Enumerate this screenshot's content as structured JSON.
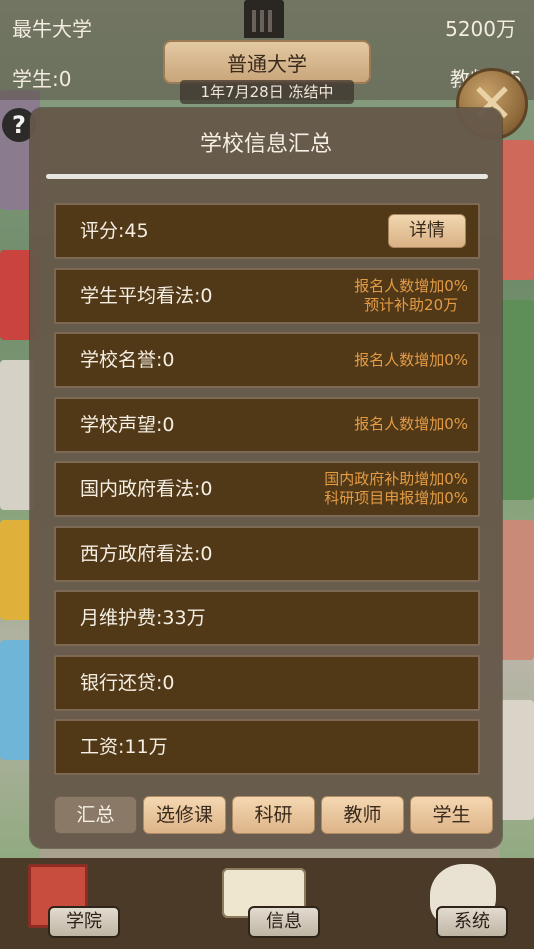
{
  "hud": {
    "university_name": "最牛大学",
    "money": "5200万",
    "students": "学生:0",
    "teachers": "教师:15",
    "level": "普通大学",
    "date_status": "1年7月28日 冻结中"
  },
  "panel": {
    "title": "学校信息汇总",
    "detail_button": "详情",
    "rows": [
      {
        "label": "评分:45",
        "notes": []
      },
      {
        "label": "学生平均看法:0",
        "notes": [
          "报名人数增加0%",
          "预计补助20万"
        ]
      },
      {
        "label": "学校名誉:0",
        "notes": [
          "报名人数增加0%"
        ]
      },
      {
        "label": "学校声望:0",
        "notes": [
          "报名人数增加0%"
        ]
      },
      {
        "label": "国内政府看法:0",
        "notes": [
          "国内政府补助增加0%",
          "科研项目申报增加0%"
        ]
      },
      {
        "label": "西方政府看法:0",
        "notes": []
      },
      {
        "label": "月维护费:33万",
        "notes": []
      },
      {
        "label": "银行还贷:0",
        "notes": []
      },
      {
        "label": "工资:11万",
        "notes": []
      }
    ],
    "tabs": [
      "汇总",
      "选修课",
      "科研",
      "教师",
      "学生"
    ],
    "active_tab": "汇总"
  },
  "nav": {
    "college": "学院",
    "info": "信息",
    "system": "系统"
  },
  "icons": {
    "help": "help-icon",
    "close": "close-icon"
  }
}
